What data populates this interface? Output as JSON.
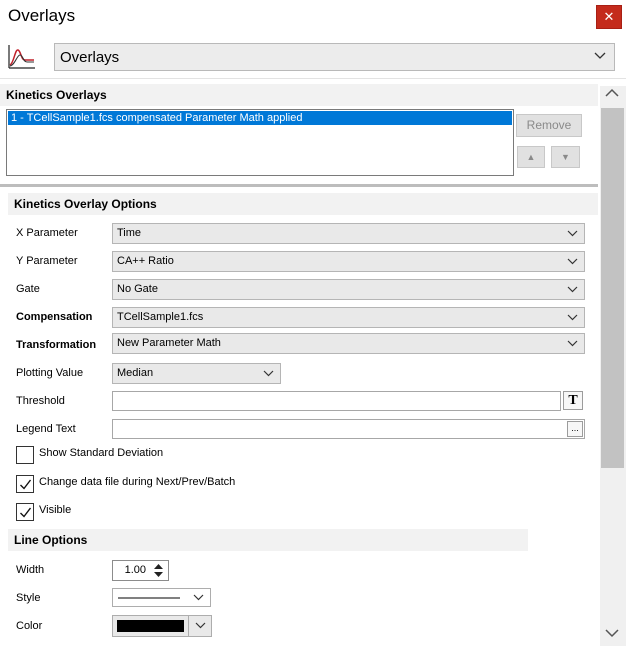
{
  "window": {
    "title": "Overlays",
    "close_glyph": "✕"
  },
  "header": {
    "icon": "kinetics-chart-icon",
    "selector_value": "Overlays"
  },
  "kinetics_overlays": {
    "title": "Kinetics Overlays",
    "items": [
      "1 - TCellSample1.fcs compensated Parameter Math applied"
    ],
    "remove_label": "Remove",
    "up_glyph": "▲",
    "down_glyph": "▼"
  },
  "options": {
    "title": "Kinetics Overlay Options",
    "x_parameter": {
      "label": "X Parameter",
      "value": "Time"
    },
    "y_parameter": {
      "label": "Y Parameter",
      "value": "CA++ Ratio"
    },
    "gate": {
      "label": "Gate",
      "value": "No Gate"
    },
    "compensation": {
      "label": "Compensation",
      "value": "TCellSample1.fcs"
    },
    "transformation": {
      "label": "Transformation",
      "value": "New Parameter Math"
    },
    "plotting_value": {
      "label": "Plotting Value",
      "value": "Median"
    },
    "threshold": {
      "label": "Threshold",
      "value": "",
      "button_glyph": "T"
    },
    "legend_text": {
      "label": "Legend Text",
      "value": "",
      "button_glyph": "..."
    },
    "show_std_dev": {
      "label": "Show Standard Deviation",
      "checked": false
    },
    "change_data_file": {
      "label": "Change data file during Next/Prev/Batch",
      "checked": true
    },
    "visible": {
      "label": "Visible",
      "checked": true
    }
  },
  "line_options": {
    "title": "Line Options",
    "width": {
      "label": "Width",
      "value": "1.00"
    },
    "style": {
      "label": "Style"
    },
    "color": {
      "label": "Color",
      "value": "#000000"
    }
  },
  "colors": {
    "selection": "#0078d7",
    "close": "#c42b1c"
  }
}
